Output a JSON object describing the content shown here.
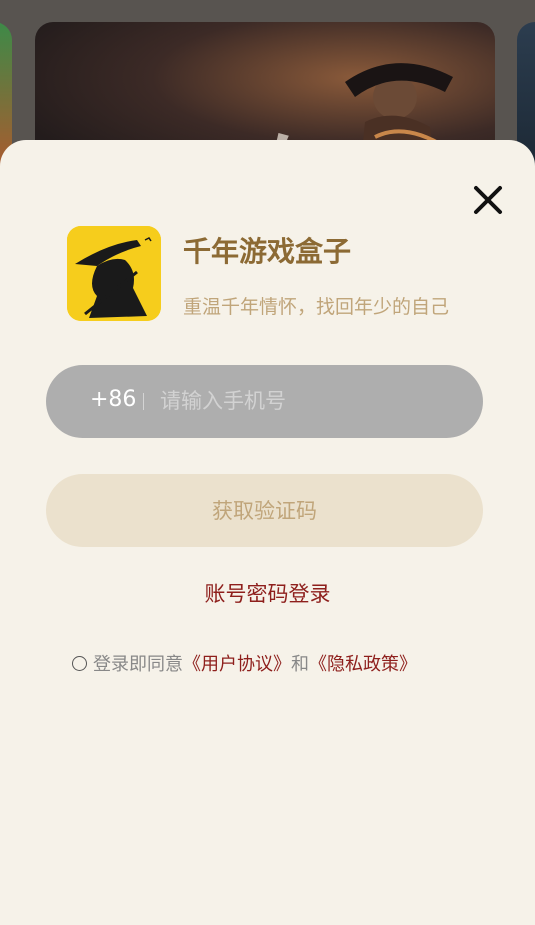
{
  "app": {
    "title": "千年游戏盒子",
    "subtitle": "重温千年情怀，找回年少的自己"
  },
  "phone": {
    "country_code": "+86",
    "placeholder": "请输入手机号",
    "value": ""
  },
  "buttons": {
    "get_code": "获取验证码",
    "password_login": "账号密码登录"
  },
  "agreement": {
    "prefix": "登录即同意",
    "user_agreement": "《用户协议》",
    "and": "和",
    "privacy_policy": "《隐私政策》"
  },
  "colors": {
    "sheet_bg": "#f6f2e9",
    "title": "#8c6a34",
    "subtitle": "#c0a57a",
    "link": "#8e1f1c",
    "input_bg": "#aeaeae",
    "button_bg": "#ebe1cd",
    "icon_bg": "#f6cd1c"
  },
  "icons": {
    "close": "close-icon",
    "app": "app-logo-icon",
    "radio": "radio-unchecked-icon"
  }
}
